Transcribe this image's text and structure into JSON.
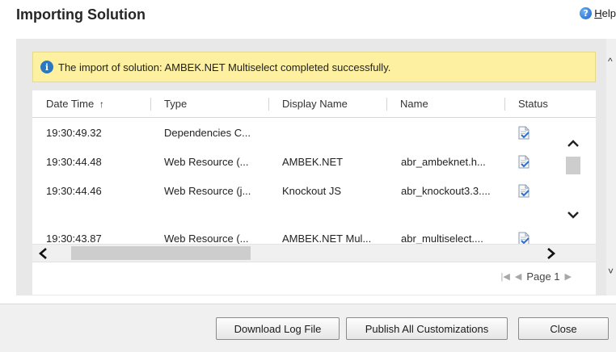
{
  "dialog": {
    "title": "Importing Solution",
    "help_label": "Help"
  },
  "banner": {
    "message": "The import of solution: AMBEK.NET Multiselect completed successfully."
  },
  "grid": {
    "columns": [
      {
        "label": "Date Time",
        "sort": "ascending"
      },
      {
        "label": "Type"
      },
      {
        "label": "Display Name"
      },
      {
        "label": "Name"
      },
      {
        "label": "Status"
      }
    ],
    "rows": [
      {
        "time": "19:30:49.32",
        "type": "Dependencies C...",
        "display_name": "",
        "name": "",
        "status_icon": "document-check-icon"
      },
      {
        "time": "19:30:44.48",
        "type": "Web Resource (...",
        "display_name": "AMBEK.NET",
        "name": "abr_ambeknet.h...",
        "status_icon": "document-check-icon"
      },
      {
        "time": "19:30:44.46",
        "type": "Web Resource (j...",
        "display_name": "Knockout JS",
        "name": "abr_knockout3.3....",
        "status_icon": "document-check-icon"
      },
      {
        "time": "19:30:43.87",
        "type": "Web Resource (...",
        "display_name": "AMBEK.NET Mul...",
        "name": "abr_multiselect....",
        "status_icon": "document-check-icon"
      }
    ],
    "pager": {
      "label": "Page 1"
    }
  },
  "buttons": {
    "download": "Download Log File",
    "publish": "Publish All Customizations",
    "close": "Close"
  },
  "colors": {
    "banner_bg": "#fdf0a0",
    "info_icon": "#2b78c2",
    "pane_bg": "#e8e8e8",
    "footer_bg": "#f0f0f0"
  }
}
